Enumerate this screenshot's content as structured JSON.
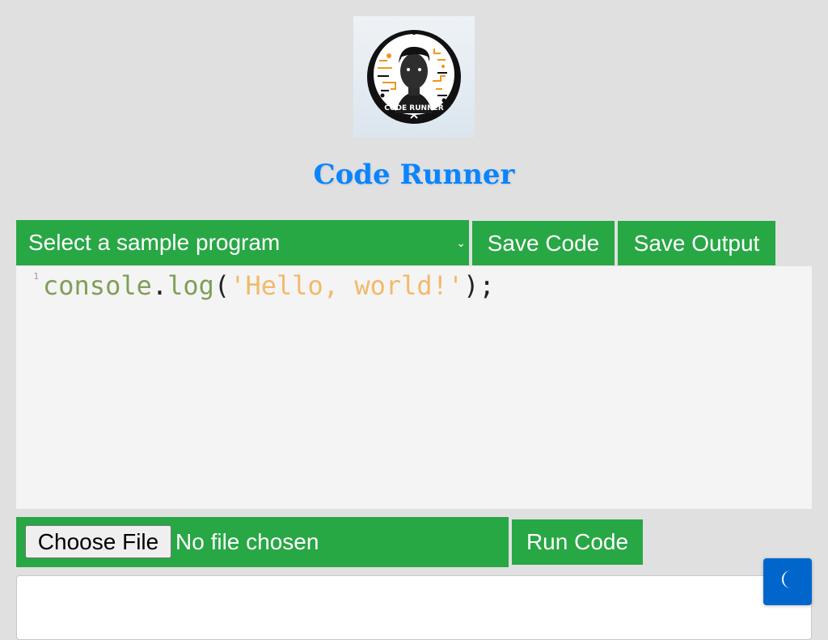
{
  "app": {
    "title": "Code Runner",
    "logo_text": "CODE RUNNER",
    "accent_color": "#0a84ff",
    "button_color": "#28a745",
    "toggle_color": "#0066cc"
  },
  "toolbar": {
    "sample_select": {
      "selected": "Select a sample program"
    },
    "save_code_label": "Save Code",
    "save_output_label": "Save Output"
  },
  "editor": {
    "lines": [
      {
        "number": "1",
        "tokens": [
          {
            "type": "ident",
            "text": "console"
          },
          {
            "type": "punc",
            "text": "."
          },
          {
            "type": "ident",
            "text": "log"
          },
          {
            "type": "punc",
            "text": "("
          },
          {
            "type": "str",
            "text": "'Hello, world!'"
          },
          {
            "type": "punc",
            "text": ");"
          }
        ]
      }
    ]
  },
  "file_upload": {
    "button_label": "Choose File",
    "status": "No file chosen"
  },
  "run_label": "Run Code",
  "output": {
    "text": ""
  },
  "theme_toggle": {
    "icon": "moon-icon"
  }
}
